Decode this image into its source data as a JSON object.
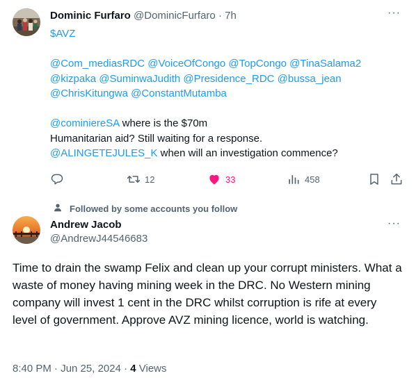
{
  "reply": {
    "author_name": "Dominic Furfaro",
    "author_handle": "@DominicFurfaro",
    "separator": "·",
    "time": "7h",
    "more_label": "···",
    "cashtag": "$AVZ",
    "mentions_line1": "@Com_mediasRDC @VoiceOfCongo @TopCongo @TinaSalama2",
    "mentions_line2": "@kizpaka @SuminwaJudith @Presidence_RDC @bussa_jean",
    "mentions_line3": "@ChrisKitungwa @ConstantMutamba",
    "line4_mention": "@cominiereSA",
    "line4_text": " where is the $70m",
    "line5_text": "Humanitarian aid? Still waiting for a response.",
    "line6_mention": "@ALINGETEJULES_K",
    "line6_text": " when will an investigation commence?",
    "actions": {
      "reply_icon": "reply-icon",
      "retweet_icon": "retweet-icon",
      "retweet_count": "12",
      "like_icon": "heart-icon",
      "like_count": "33",
      "views_icon": "views-icon",
      "views_count": "458",
      "bookmark_icon": "bookmark-icon",
      "share_icon": "share-icon"
    }
  },
  "main_tweet": {
    "social_context": "Followed by some accounts you follow",
    "author_name": "Andrew Jacob",
    "author_handle": "@AndrewJ44546683",
    "more_label": "···",
    "text": "Time to drain the swamp Felix and clean up your corrupt ministers. What a waste of money having mining week in the DRC. No Western mining company will invest 1 cent in the DRC whilst corruption is rife at every level of government. Approve AVZ mining licence, world is watching.",
    "timestamp": "8:40 PM · Jun 25, 2024 · ",
    "views_count": "4",
    "views_label": " Views"
  },
  "colors": {
    "link": "#1d9bf0",
    "muted": "#536471",
    "like": "#f91880",
    "text": "#0f1419"
  }
}
